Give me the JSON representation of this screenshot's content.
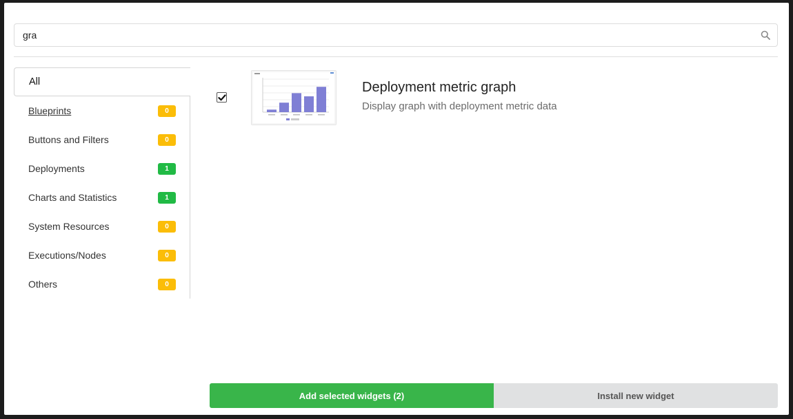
{
  "search": {
    "value": "gra",
    "placeholder": ""
  },
  "categories": [
    {
      "label": "All",
      "count": null
    },
    {
      "label": "Blueprints",
      "count": "0",
      "badge_color": "#fbbd08"
    },
    {
      "label": "Buttons and Filters",
      "count": "0",
      "badge_color": "#fbbd08"
    },
    {
      "label": "Deployments",
      "count": "1",
      "badge_color": "#21ba45"
    },
    {
      "label": "Charts and Statistics",
      "count": "1",
      "badge_color": "#21ba45"
    },
    {
      "label": "System Resources",
      "count": "0",
      "badge_color": "#fbbd08"
    },
    {
      "label": "Executions/Nodes",
      "count": "0",
      "badge_color": "#fbbd08"
    },
    {
      "label": "Others",
      "count": "0",
      "badge_color": "#fbbd08"
    }
  ],
  "widget": {
    "title": "Deployment metric graph",
    "description": "Display graph with deployment metric data",
    "checked": true,
    "thumbnail_bars": [
      0.08,
      0.3,
      0.6,
      0.5,
      0.8
    ],
    "thumbnail_bar_color": "#7f7fd5"
  },
  "footer": {
    "add_label": "Add selected widgets (2)",
    "install_label": "Install new widget",
    "add_color": "#39b54a"
  }
}
